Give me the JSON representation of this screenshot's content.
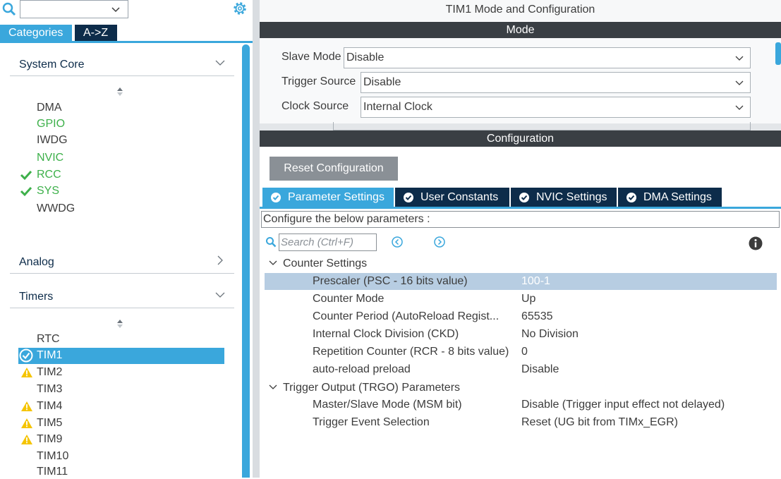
{
  "sidebar": {
    "search": {
      "value": ""
    },
    "tabs": [
      {
        "label": "Categories",
        "active": true
      },
      {
        "label": "A->Z",
        "active": false
      }
    ],
    "sections": {
      "system_core": {
        "label": "System Core",
        "items": [
          {
            "label": "DMA",
            "status": "none"
          },
          {
            "label": "GPIO",
            "status": "configured"
          },
          {
            "label": "IWDG",
            "status": "none"
          },
          {
            "label": "NVIC",
            "status": "configured"
          },
          {
            "label": "RCC",
            "status": "ok"
          },
          {
            "label": "SYS",
            "status": "ok"
          },
          {
            "label": "WWDG",
            "status": "none"
          }
        ]
      },
      "analog": {
        "label": "Analog"
      },
      "timers": {
        "label": "Timers",
        "items": [
          {
            "label": "RTC",
            "status": "none"
          },
          {
            "label": "TIM1",
            "status": "selected"
          },
          {
            "label": "TIM2",
            "status": "warning"
          },
          {
            "label": "TIM3",
            "status": "none"
          },
          {
            "label": "TIM4",
            "status": "warning"
          },
          {
            "label": "TIM5",
            "status": "warning"
          },
          {
            "label": "TIM9",
            "status": "warning"
          },
          {
            "label": "TIM10",
            "status": "none"
          },
          {
            "label": "TIM11",
            "status": "none"
          }
        ]
      }
    }
  },
  "main": {
    "title": "TIM1 Mode and Configuration",
    "mode_header": "Mode",
    "mode_rows": [
      {
        "label": "Slave Mode",
        "value": "Disable"
      },
      {
        "label": "Trigger Source",
        "value": "Disable"
      },
      {
        "label": "Clock Source",
        "value": "Internal Clock"
      }
    ],
    "config_header": "Configuration",
    "reset_label": "Reset Configuration",
    "tabs": [
      {
        "label": "Parameter Settings",
        "active": true
      },
      {
        "label": "User Constants",
        "active": false
      },
      {
        "label": "NVIC Settings",
        "active": false
      },
      {
        "label": "DMA Settings",
        "active": false
      }
    ],
    "configure_hint": "Configure the below parameters :",
    "search_placeholder": "Search (Ctrl+F)",
    "groups": [
      {
        "label": "Counter Settings",
        "params": [
          {
            "name": "Prescaler (PSC - 16 bits value)",
            "value": "100-1"
          },
          {
            "name": "Counter Mode",
            "value": "Up"
          },
          {
            "name": "Counter Period (AutoReload Regist...",
            "value": "65535"
          },
          {
            "name": "Internal Clock Division (CKD)",
            "value": "No Division"
          },
          {
            "name": "Repetition Counter (RCR - 8 bits value)",
            "value": "0"
          },
          {
            "name": "auto-reload preload",
            "value": "Disable"
          }
        ]
      },
      {
        "label": "Trigger Output (TRGO) Parameters",
        "params": [
          {
            "name": "Master/Slave Mode (MSM bit)",
            "value": "Disable (Trigger input effect not delayed)"
          },
          {
            "name": "Trigger Event Selection",
            "value": "Reset (UG bit from TIMx_EGR)"
          }
        ]
      }
    ]
  },
  "colors": {
    "accent": "#3aa7dc",
    "dark_navy": "#0d2c4a",
    "ok_green": "#3db04a",
    "warning": "#f5c400",
    "bar": "#3a3f44"
  }
}
